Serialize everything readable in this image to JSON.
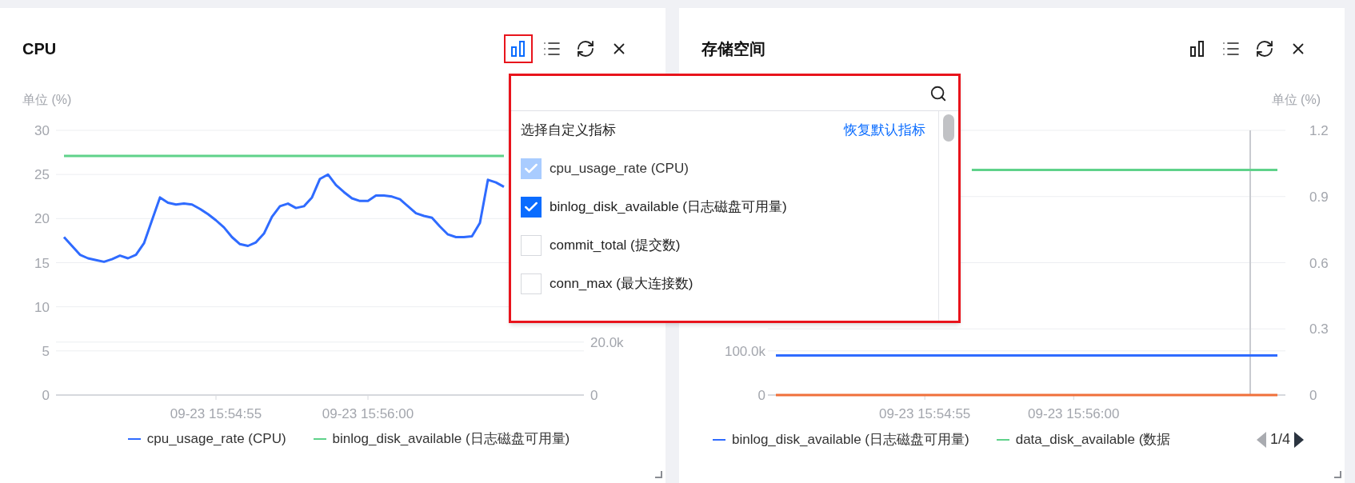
{
  "panels": [
    {
      "title": "CPU",
      "toolbar": [
        {
          "kind": "metrics",
          "selected": true
        },
        {
          "kind": "list",
          "selected": false
        },
        {
          "kind": "refresh",
          "selected": false
        },
        {
          "kind": "close",
          "selected": false
        }
      ],
      "chart_data": {
        "type": "line",
        "grid": true,
        "ylabel": "单位 (%)",
        "ylim": [
          0,
          30
        ],
        "yticks": [
          0,
          5,
          10,
          15,
          20,
          25,
          30
        ],
        "categories": [
          null,
          null,
          null,
          null,
          null,
          null,
          null,
          null,
          null,
          null,
          null,
          null,
          null,
          null,
          null,
          null,
          null,
          null,
          null,
          "09-23 15:54:55",
          null,
          null,
          null,
          null,
          null,
          null,
          null,
          null,
          null,
          null,
          null,
          null,
          null,
          null,
          null,
          null,
          null,
          null,
          "09-23 15:56:00",
          null,
          null,
          null,
          null,
          null,
          null,
          null,
          null,
          null,
          null,
          null,
          null,
          null,
          null,
          null,
          null,
          null,
          null,
          null,
          null,
          null,
          null,
          null,
          null,
          null,
          null
        ],
        "series": [
          {
            "name": "cpu_usage_rate (CPU)",
            "color": "#2f6bff",
            "values": [
              17.9,
              16.9,
              15.9,
              15.5,
              15.3,
              15.1,
              15.4,
              15.8,
              15.5,
              15.9,
              17.2,
              19.8,
              22.4,
              21.8,
              21.6,
              21.7,
              21.6,
              21.1,
              20.5,
              19.8,
              19.0,
              17.9,
              17.1,
              16.9,
              17.3,
              18.3,
              20.2,
              21.4,
              21.7,
              21.2,
              21.4,
              22.4,
              24.5,
              25.0,
              23.8,
              23.0,
              22.3,
              22.0,
              22.0,
              22.6,
              22.6,
              22.5,
              22.2,
              21.4,
              20.6,
              20.3,
              20.1,
              19.1,
              18.2,
              17.9,
              17.9,
              18.0,
              19.5,
              24.4,
              24.1,
              23.6,
              null,
              null,
              null,
              null,
              null,
              null,
              null,
              null,
              null
            ]
          },
          {
            "name": "binlog_disk_available (日志磁盘可用量)",
            "color": "#5fd28a",
            "values": [
              27.1,
              27.1,
              27.1,
              27.1,
              27.1,
              27.1,
              27.1,
              27.1,
              27.1,
              27.1,
              27.1,
              27.1,
              27.1,
              27.1,
              27.1,
              27.1,
              27.1,
              27.1,
              27.1,
              27.1,
              27.1,
              27.1,
              27.1,
              27.1,
              27.1,
              27.1,
              27.1,
              27.1,
              27.1,
              27.1,
              27.1,
              27.1,
              27.1,
              27.1,
              27.1,
              27.1,
              27.1,
              27.1,
              27.1,
              27.1,
              27.1,
              27.1,
              27.1,
              27.1,
              27.1,
              27.1,
              27.1,
              27.1,
              27.1,
              27.1,
              27.1,
              27.1,
              27.1,
              27.1,
              27.1,
              27.1,
              null,
              null,
              null,
              null,
              null,
              null,
              null,
              null,
              null
            ]
          }
        ]
      },
      "secondary_ticks": [
        "20.0k",
        "0"
      ]
    },
    {
      "title": "存储空间",
      "toolbar": [
        {
          "kind": "metrics",
          "selected": false
        },
        {
          "kind": "list",
          "selected": false
        },
        {
          "kind": "refresh",
          "selected": false
        },
        {
          "kind": "close",
          "selected": false
        }
      ],
      "chart_data": {
        "type": "line",
        "grid": true,
        "ylabel": "单位 (%)",
        "ylim": [
          0,
          1.2
        ],
        "yticks": [
          {
            "value": 0,
            "label": "0"
          },
          {
            "value": 0.3,
            "label": "0.3"
          },
          {
            "value": 0.6,
            "label": "0.6"
          },
          {
            "value": 0.9,
            "label": "0.9"
          },
          {
            "value": 1.2,
            "label": "1.2"
          }
        ],
        "categories": [
          null,
          null,
          null,
          null,
          null,
          null,
          null,
          null,
          null,
          null,
          null,
          null,
          null,
          null,
          null,
          null,
          null,
          null,
          null,
          "09-23 15:54:55",
          null,
          null,
          null,
          null,
          null,
          null,
          null,
          null,
          null,
          null,
          null,
          null,
          null,
          null,
          null,
          null,
          null,
          null,
          "09-23 15:56:00",
          null,
          null,
          null,
          null,
          null,
          null,
          null,
          null,
          null,
          null,
          null,
          null,
          null,
          null,
          null,
          null,
          null,
          null,
          null,
          null,
          null,
          null,
          null,
          null,
          null,
          null
        ],
        "series": [
          {
            "name": "binlog_disk_available (日志磁盘可用量)",
            "color": "#2f6bff",
            "values": [
              0.18,
              0.18,
              0.18,
              0.18,
              0.18,
              0.18,
              0.18,
              0.18,
              0.18,
              0.18,
              0.18,
              0.18,
              0.18,
              0.18,
              0.18,
              0.18,
              0.18,
              0.18,
              0.18,
              0.18,
              0.18,
              0.18,
              0.18,
              0.18,
              0.18,
              0.18,
              0.18,
              0.18,
              0.18,
              0.18,
              0.18,
              0.18,
              0.18,
              0.18,
              0.18,
              0.18,
              0.18,
              0.18,
              0.18,
              0.18,
              0.18,
              0.18,
              0.18,
              0.18,
              0.18,
              0.18,
              0.18,
              0.18,
              0.18,
              0.18,
              0.18,
              0.18,
              0.18,
              0.18,
              0.18,
              0.18,
              0.18,
              0.18,
              0.18,
              0.18,
              0.18,
              0.18,
              0.18,
              0.18,
              0.18
            ]
          },
          {
            "name": "data_disk_available (数据",
            "color": "#5fd28a",
            "values": [
              null,
              null,
              null,
              null,
              null,
              null,
              null,
              null,
              null,
              null,
              null,
              null,
              null,
              null,
              null,
              null,
              null,
              null,
              null,
              null,
              null,
              null,
              null,
              null,
              null,
              1.02,
              1.02,
              1.02,
              1.02,
              1.02,
              1.02,
              1.02,
              1.02,
              1.02,
              1.02,
              1.02,
              1.02,
              1.02,
              1.02,
              1.02,
              1.02,
              1.02,
              1.02,
              1.02,
              1.02,
              1.02,
              1.02,
              1.02,
              1.02,
              1.02,
              1.02,
              1.02,
              1.02,
              1.02,
              1.02,
              1.02,
              1.02,
              1.02,
              1.02,
              1.02,
              1.02,
              1.02,
              1.02,
              1.02,
              1.02
            ]
          },
          {
            "color": "#f0703a",
            "values": [
              0,
              0,
              0,
              0,
              0,
              0,
              0,
              0,
              0,
              0,
              0,
              0,
              0,
              0,
              0,
              0,
              0,
              0,
              0,
              0,
              0,
              0,
              0,
              0,
              0,
              0,
              0,
              0,
              0,
              0,
              0,
              0,
              0,
              0,
              0,
              0,
              0,
              0,
              0,
              0,
              0,
              0,
              0,
              0,
              0,
              0,
              0,
              0,
              0,
              0,
              0,
              0,
              0,
              0,
              0,
              0,
              0,
              0,
              0,
              0,
              0,
              0,
              0,
              0,
              0
            ]
          }
        ]
      },
      "secondary_ticks": [
        "100.0k",
        "0"
      ],
      "legend_pager": {
        "text": "1/4",
        "prev_disabled": true,
        "next_disabled": false
      }
    }
  ],
  "metric_popup": {
    "title": "选择自定义指标",
    "reset_link": "恢复默认指标",
    "items": [
      {
        "label": "cpu_usage_rate (CPU)",
        "checked": true,
        "disabled": true
      },
      {
        "label": "binlog_disk_available (日志磁盘可用量)",
        "checked": true,
        "disabled": false
      },
      {
        "label": "commit_total (提交数)",
        "checked": false,
        "disabled": false
      },
      {
        "label": "conn_max (最大连接数)",
        "checked": false,
        "disabled": false
      }
    ]
  }
}
